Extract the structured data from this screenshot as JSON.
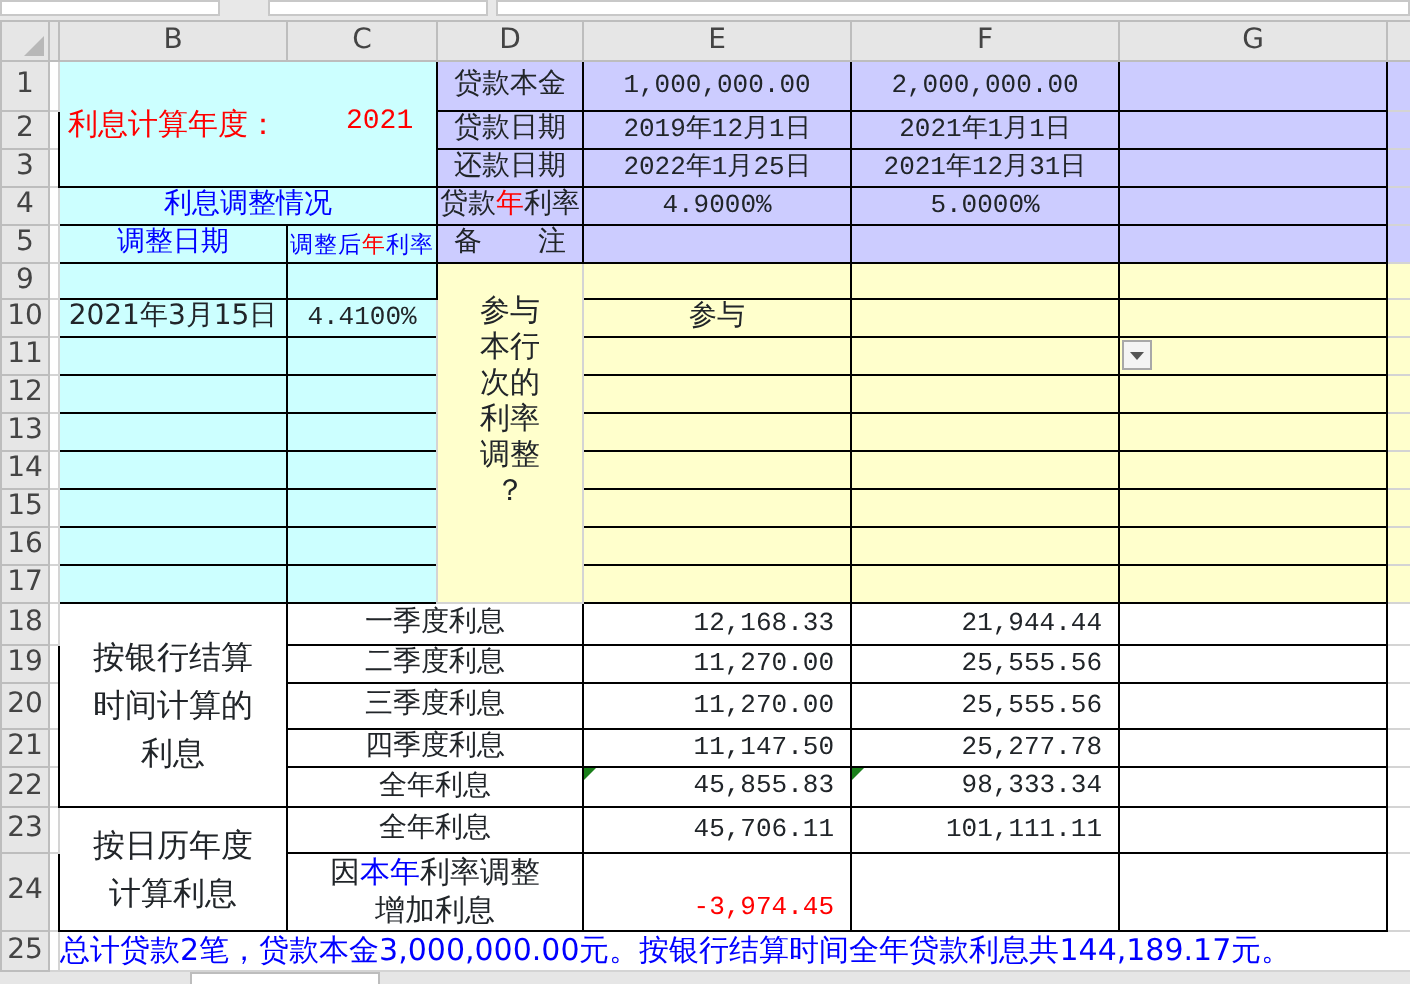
{
  "column_headers": [
    "B",
    "C",
    "D",
    "E",
    "F",
    "G"
  ],
  "row_numbers": [
    "1",
    "2",
    "3",
    "4",
    "5",
    "9",
    "10",
    "11",
    "12",
    "13",
    "14",
    "15",
    "16",
    "17",
    "18",
    "19",
    "20",
    "21",
    "22",
    "23",
    "24",
    "25"
  ],
  "settings": {
    "year_label": "利息计算年度：",
    "year": "2021"
  },
  "loan_fields": [
    {
      "label": {
        "before": "贷款本金"
      },
      "values": [
        "1,000,000.00",
        "2,000,000.00"
      ]
    },
    {
      "label": {
        "before": "贷款日期"
      },
      "values": [
        "2019年12月1日",
        "2021年1月1日"
      ]
    },
    {
      "label": {
        "before": "还款日期"
      },
      "values": [
        "2022年1月25日",
        "2021年12月31日"
      ]
    },
    {
      "label": {
        "before": "贷款",
        "highlight": "年",
        "after": "利率"
      },
      "values": [
        "4.9000%",
        "5.0000%"
      ]
    }
  ],
  "remark_label": "备　　注",
  "adjustments": {
    "title": "利息调整情况",
    "date_header": "调整日期",
    "rate_header": {
      "before": "调整后",
      "highlight": "年",
      "after": "利率"
    }
  },
  "participation_question": "参与本行次的利率调整？",
  "adjustment_rows": [
    {
      "has_dropdown": false
    },
    {
      "date": "2021年3月15日",
      "rate": "4.4100%",
      "participation": "参与",
      "has_dropdown": false
    },
    {
      "has_dropdown": true
    },
    {
      "has_dropdown": false
    },
    {
      "has_dropdown": false
    },
    {
      "has_dropdown": false
    },
    {
      "has_dropdown": false
    },
    {
      "has_dropdown": false
    },
    {
      "has_dropdown": false
    }
  ],
  "bank_interest": {
    "label": "按银行结算时间计算的利息",
    "rows": [
      {
        "label": "一季度利息",
        "values": [
          "12,168.33",
          "21,944.44"
        ],
        "flagged": false
      },
      {
        "label": "二季度利息",
        "values": [
          "11,270.00",
          "25,555.56"
        ],
        "flagged": false
      },
      {
        "label": "三季度利息",
        "values": [
          "11,270.00",
          "25,555.56"
        ],
        "flagged": false
      },
      {
        "label": "四季度利息",
        "values": [
          "11,147.50",
          "25,277.78"
        ],
        "flagged": false
      },
      {
        "label": "全年利息",
        "values": [
          "45,855.83",
          "98,333.34"
        ],
        "flagged": true
      }
    ]
  },
  "calendar_interest": {
    "label": "按日历年度计算利息",
    "rows": [
      {
        "label": {
          "before": "全年利息"
        },
        "values": [
          "45,706.11",
          "101,111.11"
        ],
        "negative": false
      },
      {
        "label": {
          "before": "因",
          "highlight": "本年",
          "after": "利率调整增加利息"
        },
        "values": [
          "-3,974.45"
        ],
        "negative": true
      }
    ]
  },
  "summary": "总计贷款2笔，贷款本金3,000,000.00元。按银行结算时间全年贷款利息共144,189.17元。",
  "sheet_tabs": [
    {
      "selected": true
    }
  ]
}
